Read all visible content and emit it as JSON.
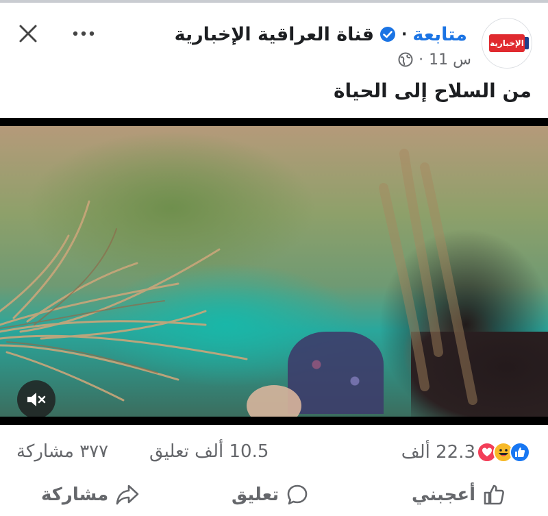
{
  "header": {
    "page_name": "قناة العراقية الإخبارية",
    "separator": "·",
    "follow_label": "متابعة",
    "time": "11 س",
    "meta_dot": "·",
    "avatar_logo_text": "الإخبارية",
    "avatar_colors": {
      "red": "#e02a2f",
      "blue": "#1f3f8a"
    }
  },
  "post": {
    "caption": "من السلاح إلى الحياة"
  },
  "video": {
    "muted": true
  },
  "stats": {
    "reactions_count": "22.3 ألف",
    "comments_count": "10.5 ألف تعليق",
    "shares_count": "٣٧٧ مشاركة",
    "reaction_icons": [
      "like-icon",
      "haha-icon",
      "love-icon"
    ]
  },
  "actions": {
    "like_label": "أعجبني",
    "comment_label": "تعليق",
    "share_label": "مشاركة"
  },
  "colors": {
    "accent": "#1b74e4",
    "like_blue": "#1877f2",
    "love_red": "#f33e58",
    "haha_yellow": "#f7b928",
    "secondary_text": "#65676b"
  }
}
